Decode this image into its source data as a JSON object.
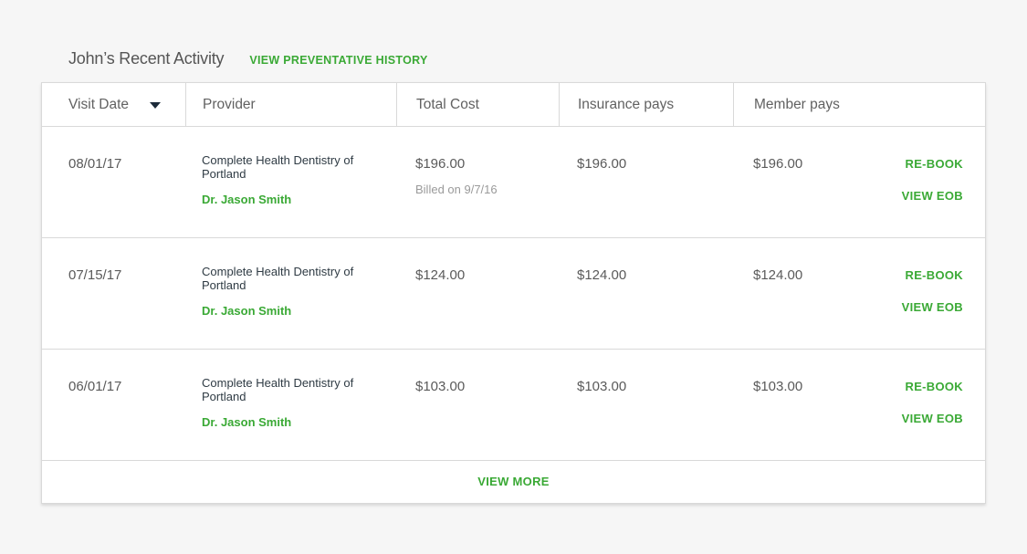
{
  "header": {
    "title": "John’s Recent Activity",
    "history_link": "VIEW PREVENTATIVE HISTORY"
  },
  "table": {
    "columns": [
      "Visit Date",
      "Provider",
      "Total Cost",
      "Insurance pays",
      "Member pays"
    ],
    "sort_icon": "caret-down-icon",
    "rows": [
      {
        "date": "08/01/17",
        "provider": "Complete Health Dentistry of Portland",
        "doctor": "Dr. Jason Smith",
        "total": "$196.00",
        "billed": "Billed on 9/7/16",
        "insurance": "$196.00",
        "member": "$196.00",
        "rebook": "RE-BOOK",
        "eob": "VIEW EOB"
      },
      {
        "date": "07/15/17",
        "provider": "Complete Health Dentistry of Portland",
        "doctor": "Dr. Jason Smith",
        "total": "$124.00",
        "insurance": "$124.00",
        "member": "$124.00",
        "rebook": "RE-BOOK",
        "eob": "VIEW EOB"
      },
      {
        "date": "06/01/17",
        "provider": "Complete Health Dentistry of Portland",
        "doctor": "Dr. Jason Smith",
        "total": "$103.00",
        "insurance": "$103.00",
        "member": "$103.00",
        "rebook": "RE-BOOK",
        "eob": "VIEW EOB"
      }
    ],
    "view_more": "VIEW MORE"
  },
  "colors": {
    "accent": "#3aa935",
    "border": "#d9d9d9",
    "background": "#f6f6f6"
  }
}
